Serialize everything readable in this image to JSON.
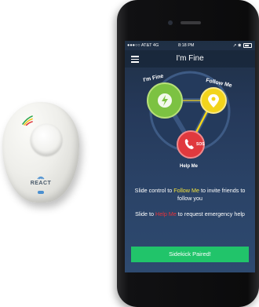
{
  "device": {
    "brand": "REACT"
  },
  "status_bar": {
    "carrier": "●●●○○ AT&T  4G",
    "time": "8:18 PM",
    "right_icons": "↗ ✱"
  },
  "navbar": {
    "title": "I'm Fine",
    "menu_icon": "hamburger-menu-icon"
  },
  "diagram": {
    "node_fine_label": "I'm Fine",
    "node_follow_label": "Follow Me",
    "node_help_label": "Help Me",
    "node_help_badge": "SOS",
    "colors": {
      "fine": "#7cc242",
      "follow": "#f2d41c",
      "help": "#e0393e",
      "track": "#3a5680"
    }
  },
  "instructions": {
    "line1_prefix": "Slide control to ",
    "line1_highlight": "Follow Me",
    "line1_suffix": " to invite friends to follow you",
    "line2_prefix": "Slide to ",
    "line2_highlight": "Help Me",
    "line2_suffix": " to request emergency help"
  },
  "footer": {
    "paired_button_label": "Sidekick Paired!"
  }
}
